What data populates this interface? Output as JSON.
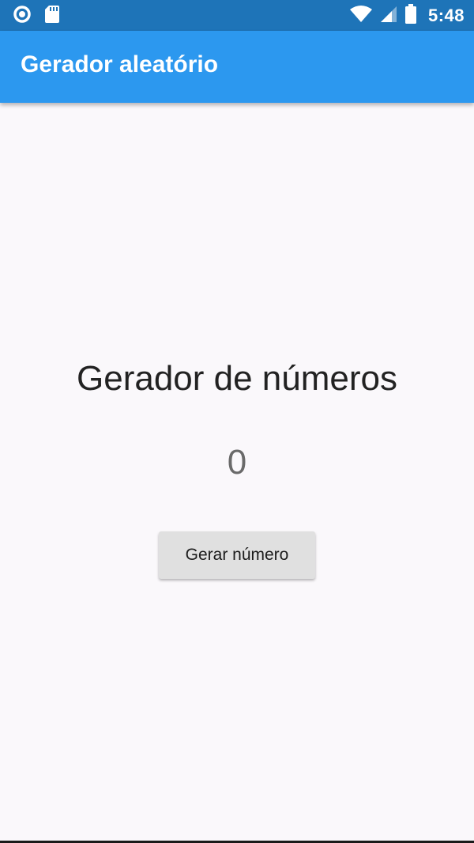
{
  "status_bar": {
    "time": "5:48",
    "icons": [
      "circle-notification-icon",
      "sd-card-icon",
      "wifi-icon",
      "cell-signal-icon",
      "battery-icon"
    ]
  },
  "app_bar": {
    "title": "Gerador aleatório"
  },
  "main": {
    "headline": "Gerador de números",
    "number": "0",
    "button_label": "Gerar número"
  },
  "colors": {
    "status_bar": "#1e74b8",
    "app_bar": "#2c98ef",
    "background": "#faf8fb",
    "button": "#e0e0e0"
  }
}
